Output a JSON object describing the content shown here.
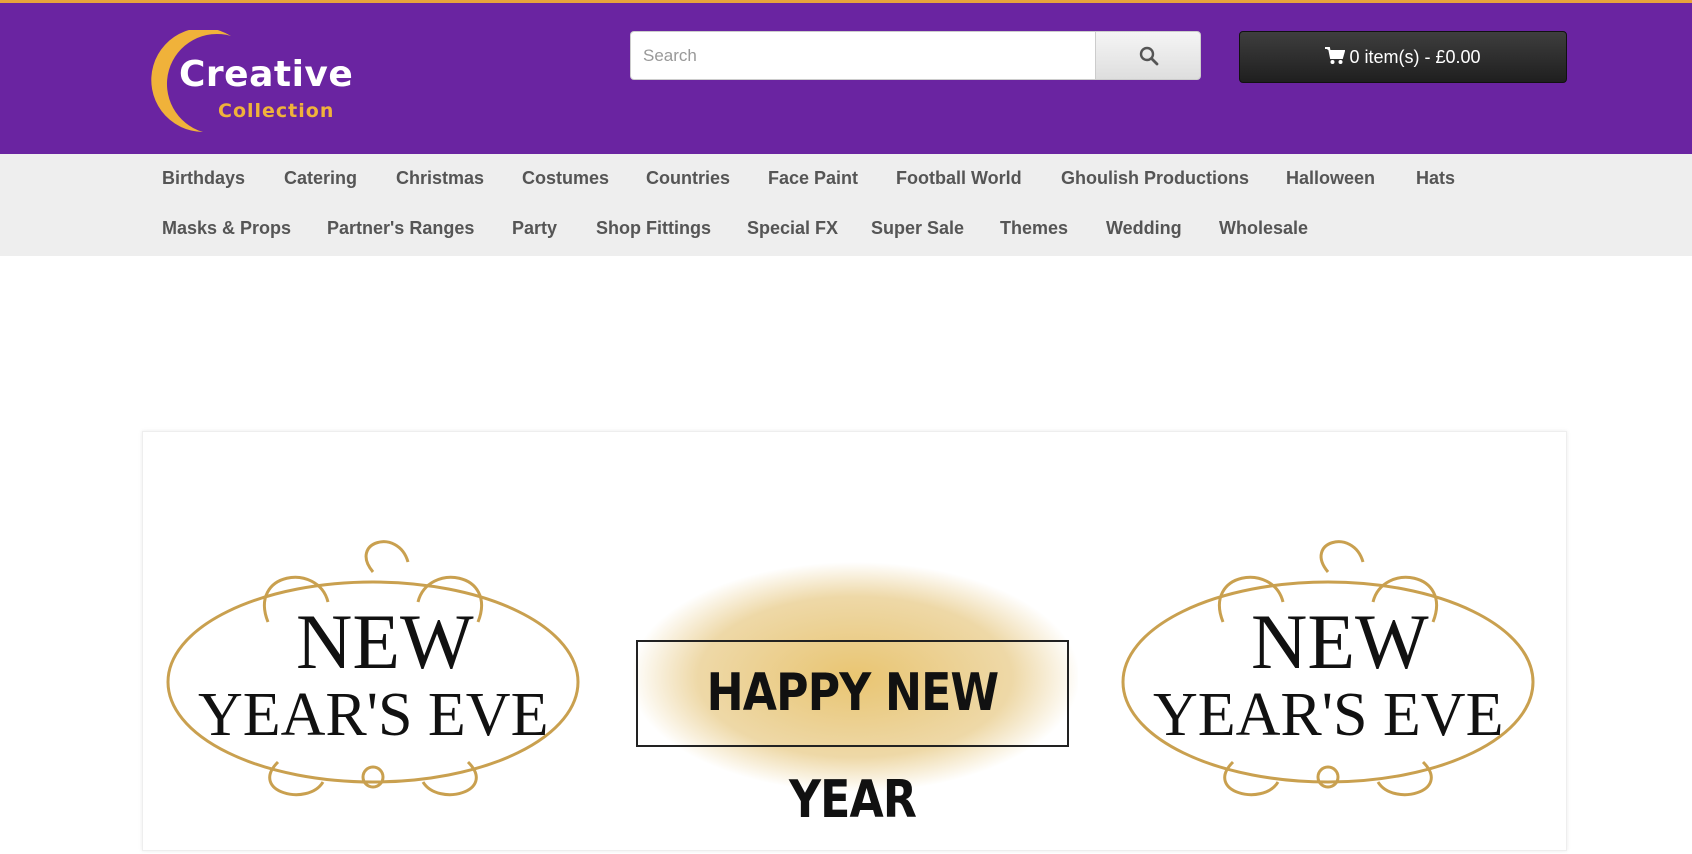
{
  "brand": {
    "logo_line1": "Creative",
    "logo_line2": "Collection",
    "colors": {
      "header_bg": "#6a24a1",
      "accent": "#f0b23a",
      "nav_bg": "#eeeeee"
    }
  },
  "search": {
    "placeholder": "Search",
    "value": "",
    "button_icon": "search-icon"
  },
  "cart": {
    "label": "0 item(s) - £0.00",
    "icon": "cart-icon"
  },
  "nav": {
    "row1": [
      "Birthdays",
      "Catering",
      "Christmas",
      "Costumes",
      "Countries",
      "Face Paint",
      "Football World",
      "Ghoulish Productions",
      "Halloween",
      "Hats"
    ],
    "row2": [
      "Masks & Props",
      "Partner's Ranges",
      "Party",
      "Shop Fittings",
      "Special FX",
      "Super Sale",
      "Themes",
      "Wedding",
      "Wholesale"
    ]
  },
  "banner": {
    "left_line1": "NEW",
    "left_line2": "YEAR'S EVE",
    "center": "HAPPY NEW YEAR",
    "right_line1": "NEW",
    "right_line2": "YEAR'S EVE"
  }
}
